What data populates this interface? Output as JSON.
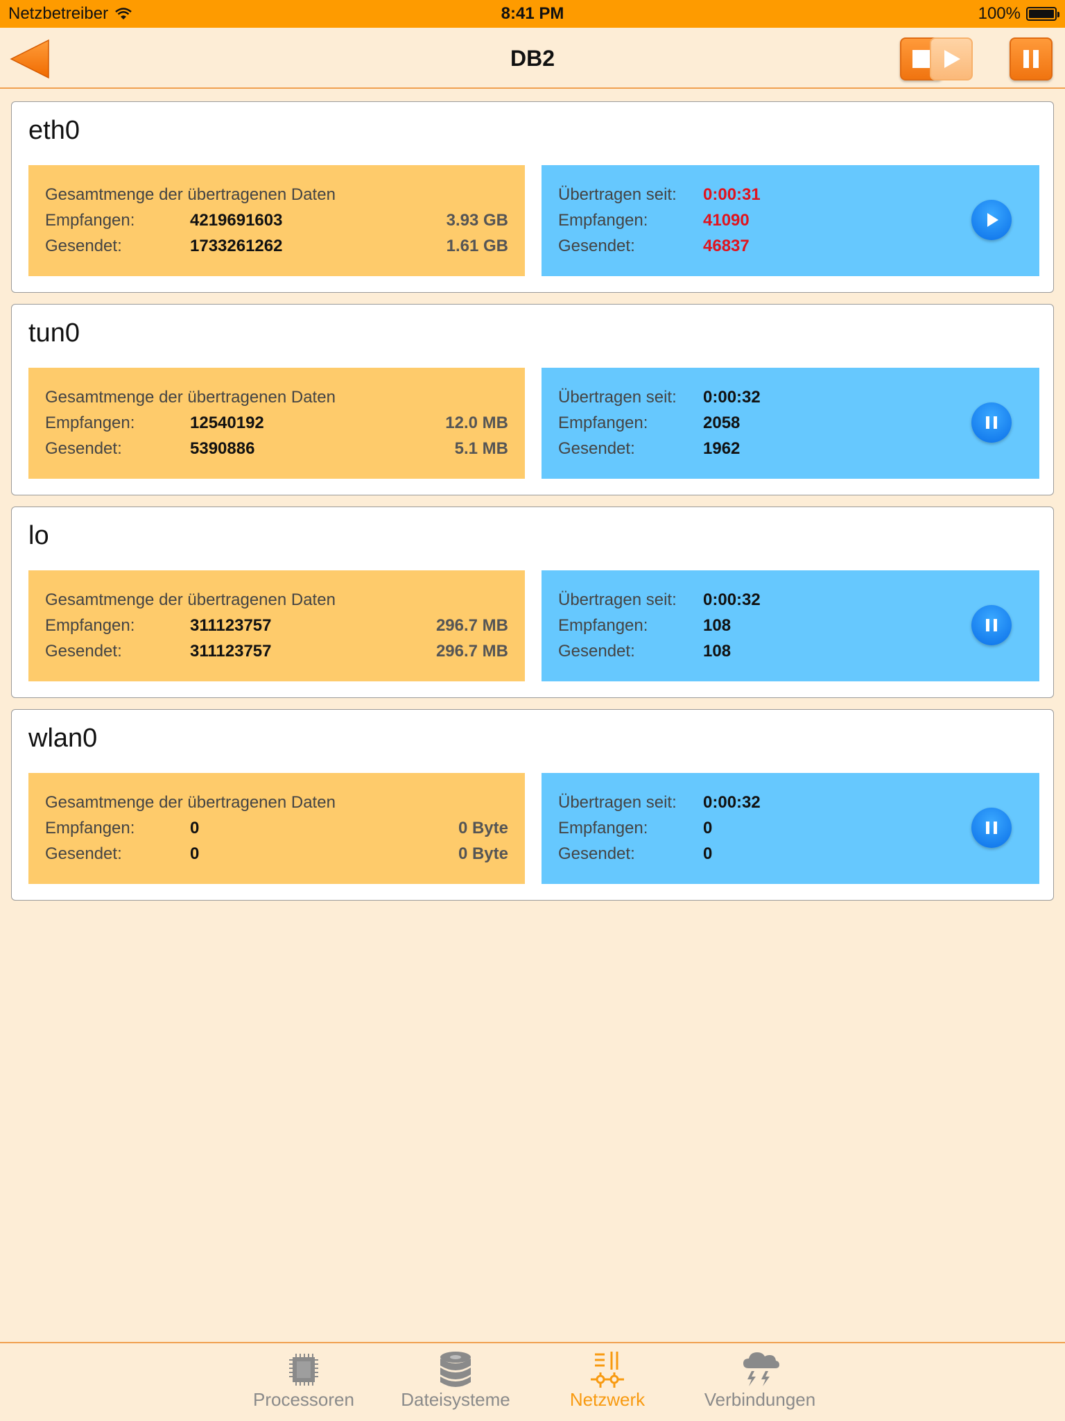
{
  "status_bar": {
    "carrier": "Netzbetreiber",
    "time": "8:41 PM",
    "battery": "100%"
  },
  "nav": {
    "title": "DB2"
  },
  "cards": [
    {
      "name": "eth0",
      "total": {
        "heading": "Gesamtmenge der übertragenen Daten",
        "received_label": "Empfangen:",
        "received": "4219691603",
        "received_size": "3.93 GB",
        "sent_label": "Gesendet:",
        "sent": "1733261262",
        "sent_size": "1.61 GB"
      },
      "live": {
        "since_label": "Übertragen seit:",
        "since": "0:00:31",
        "received_label": "Empfangen:",
        "received": "41090",
        "sent_label": "Gesendet:",
        "sent": "46837"
      },
      "state": "paused",
      "highlight_color": "#e0141e"
    },
    {
      "name": "tun0",
      "total": {
        "heading": "Gesamtmenge der übertragenen Daten",
        "received_label": "Empfangen:",
        "received": "12540192",
        "received_size": "12.0 MB",
        "sent_label": "Gesendet:",
        "sent": "5390886",
        "sent_size": "5.1 MB"
      },
      "live": {
        "since_label": "Übertragen seit:",
        "since": "0:00:32",
        "received_label": "Empfangen:",
        "received": "2058",
        "sent_label": "Gesendet:",
        "sent": "1962"
      },
      "state": "running"
    },
    {
      "name": "lo",
      "total": {
        "heading": "Gesamtmenge der übertragenen Daten",
        "received_label": "Empfangen:",
        "received": "311123757",
        "received_size": "296.7 MB",
        "sent_label": "Gesendet:",
        "sent": "311123757",
        "sent_size": "296.7 MB"
      },
      "live": {
        "since_label": "Übertragen seit:",
        "since": "0:00:32",
        "received_label": "Empfangen:",
        "received": "108",
        "sent_label": "Gesendet:",
        "sent": "108"
      },
      "state": "running"
    },
    {
      "name": "wlan0",
      "total": {
        "heading": "Gesamtmenge der übertragenen Daten",
        "received_label": "Empfangen:",
        "received": "0",
        "received_size": "0 Byte",
        "sent_label": "Gesendet:",
        "sent": "0",
        "sent_size": "0 Byte"
      },
      "live": {
        "since_label": "Übertragen seit:",
        "since": "0:00:32",
        "received_label": "Empfangen:",
        "received": "0",
        "sent_label": "Gesendet:",
        "sent": "0"
      },
      "state": "running"
    }
  ],
  "tabs": [
    {
      "label": "Processoren",
      "icon": "cpu-icon"
    },
    {
      "label": "Dateisysteme",
      "icon": "database-icon"
    },
    {
      "label": "Netzwerk",
      "icon": "network-icon",
      "active": true
    },
    {
      "label": "Verbindungen",
      "icon": "storm-cloud-icon"
    }
  ],
  "colors": {
    "accent": "#fe9b00",
    "total_panel": "#fecb6b",
    "live_panel": "#66c8fe",
    "background": "#fdedd6",
    "active_tab": "#f89a10"
  }
}
